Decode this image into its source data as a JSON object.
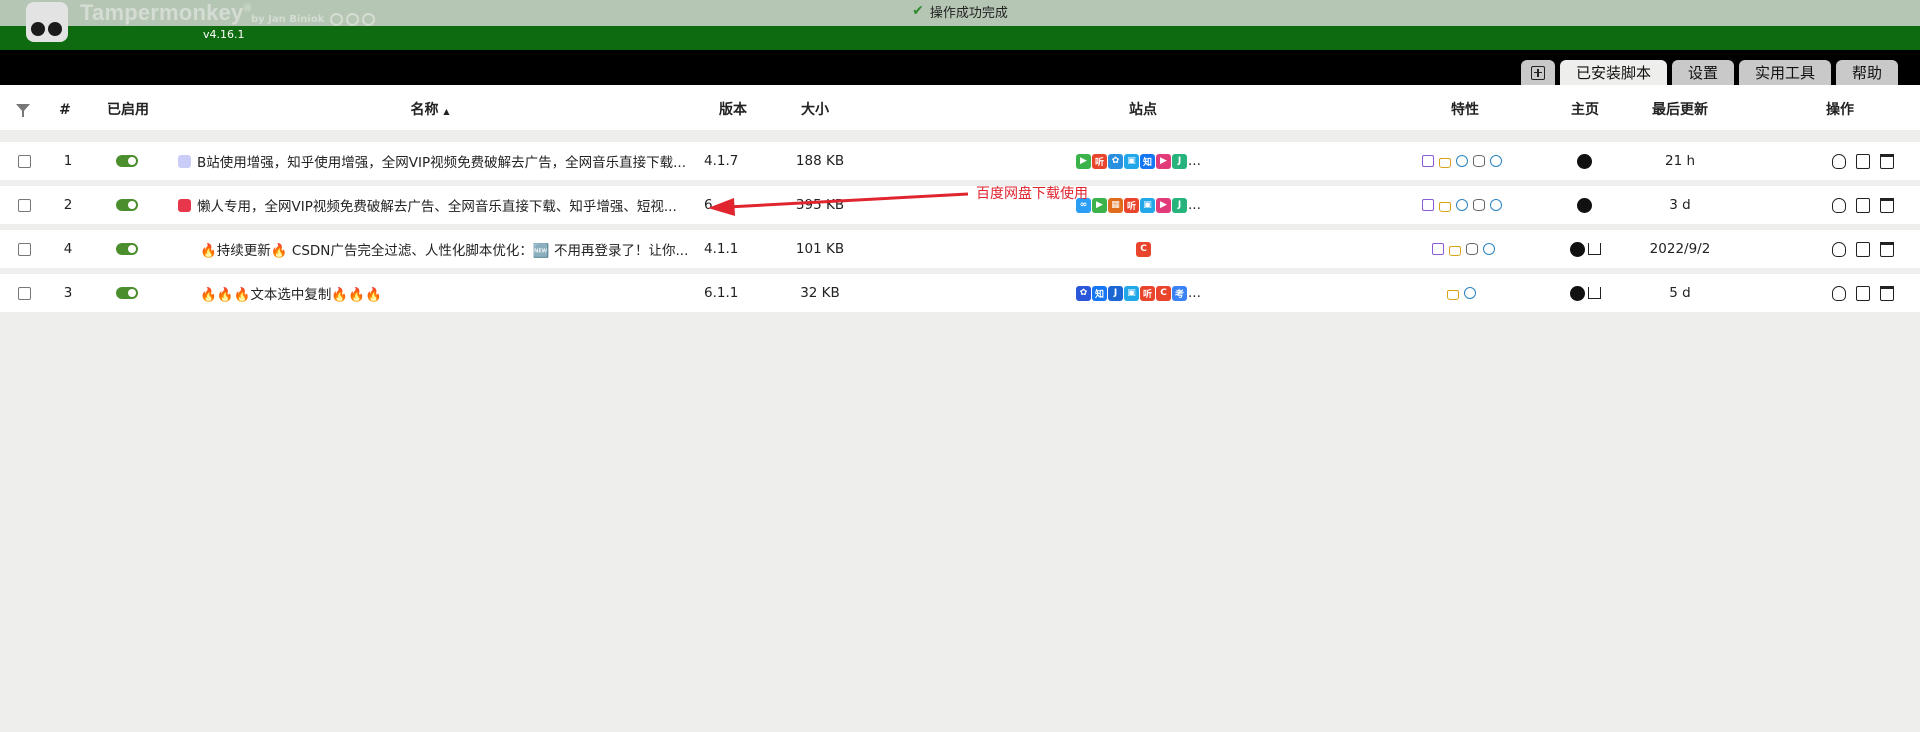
{
  "notice": {
    "text": "操作成功完成"
  },
  "header": {
    "brand": "Tampermonkey",
    "reg": "®",
    "by": "by Jan Biniok",
    "version": "v4.16.1"
  },
  "tabs": [
    {
      "label": ""
    },
    {
      "label": "已安装脚本"
    },
    {
      "label": "设置"
    },
    {
      "label": "实用工具"
    },
    {
      "label": "帮助"
    }
  ],
  "columns": {
    "num": "#",
    "enabled": "已启用",
    "name": "名称",
    "sort_indicator": "▲",
    "version": "版本",
    "size": "大小",
    "sites": "站点",
    "features": "特性",
    "homepage": "主页",
    "updated": "最后更新",
    "actions": "操作"
  },
  "rows": [
    {
      "num": "1",
      "name": "B站使用增强，知乎使用增强，全网VIP视频免费破解去广告，全网音乐直接下载...",
      "version": "4.1.7",
      "size": "188 KB",
      "updated": "21 h",
      "sites_more": "..."
    },
    {
      "num": "2",
      "name": "懒人专用，全网VIP视频免费破解去广告、全网音乐直接下载、知乎增强、短视...",
      "version": "6.",
      "size": "395 KB",
      "updated": "3 d",
      "sites_more": "..."
    },
    {
      "num": "4",
      "name": "🔥持续更新🔥 CSDN广告完全过滤、人性化脚本优化：🆕 不用再登录了！让你...",
      "version": "4.1.1",
      "size": "101 KB",
      "updated": "2022/9/2",
      "sites_more": ""
    },
    {
      "num": "3",
      "name": "🔥🔥🔥文本选中复制🔥🔥🔥",
      "version": "6.1.1",
      "size": "32 KB",
      "updated": "5 d",
      "sites_more": "..."
    }
  ],
  "annotation": {
    "text": "百度网盘下载使用"
  },
  "colors": {
    "header_green": "#0f6b0f",
    "toggle_on": "#4b8e2d",
    "annotation_red": "#e0252f"
  }
}
